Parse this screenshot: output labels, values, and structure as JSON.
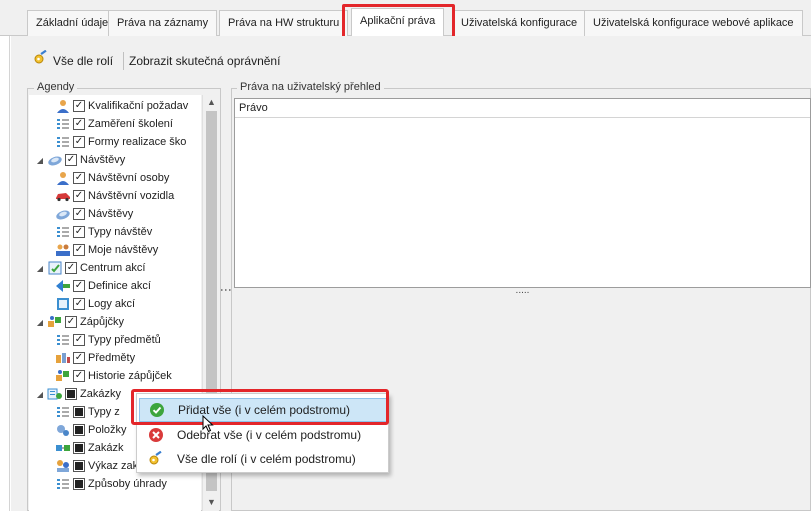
{
  "tabs": [
    {
      "label": "Základní údaje"
    },
    {
      "label": "Práva na záznamy"
    },
    {
      "label": "Práva na HW strukturu"
    },
    {
      "label": "Aplikační práva"
    },
    {
      "label": "Uživatelská konfigurace"
    },
    {
      "label": "Uživatelská konfigurace webové aplikace"
    }
  ],
  "toolbar": {
    "role_button": "Vše dle rolí",
    "show_button": "Zobrazit skutečná oprávnění"
  },
  "agendy": {
    "title": "Agendy",
    "items": [
      {
        "label": "Kvalifikační požadav",
        "icon": "person-icon",
        "checked": true
      },
      {
        "label": "Zaměření školení",
        "icon": "list-icon",
        "checked": true
      },
      {
        "label": "Formy realizace ško",
        "icon": "list-icon",
        "checked": true
      },
      {
        "label": "Návštěvy",
        "icon": "visit-icon",
        "checked": true
      },
      {
        "label": "Návštěvní osoby",
        "icon": "person-icon",
        "checked": true
      },
      {
        "label": "Návštěvní vozidla",
        "icon": "car-icon",
        "checked": true
      },
      {
        "label": "Návštěvy",
        "icon": "visit-icon",
        "checked": true
      },
      {
        "label": "Typy návštěv",
        "icon": "list-icon",
        "checked": true
      },
      {
        "label": "Moje návštěvy",
        "icon": "people-icon",
        "checked": true
      },
      {
        "label": "Centrum akcí",
        "icon": "action-center-icon",
        "checked": true
      },
      {
        "label": "Definice akcí",
        "icon": "flag-icon",
        "checked": true
      },
      {
        "label": "Logy akcí",
        "icon": "log-icon",
        "checked": true
      },
      {
        "label": "Zápůjčky",
        "icon": "loan-icon",
        "checked": true
      },
      {
        "label": "Typy předmětů",
        "icon": "list-icon",
        "checked": true
      },
      {
        "label": "Předměty",
        "icon": "items-icon",
        "checked": true
      },
      {
        "label": "Historie zápůjček",
        "icon": "loan-icon",
        "checked": true
      },
      {
        "label": "Zakázky",
        "icon": "orders-icon",
        "checked": "mixed"
      },
      {
        "label": "Typy z",
        "icon": "list-icon",
        "checked": "mixed"
      },
      {
        "label": "Položky",
        "icon": "item-icon",
        "checked": "mixed"
      },
      {
        "label": "Zakázk",
        "icon": "order-icon",
        "checked": "mixed"
      },
      {
        "label": "Výkaz zakázek",
        "icon": "report-icon",
        "checked": "mixed"
      },
      {
        "label": "Způsoby úhrady",
        "icon": "list-icon",
        "checked": "mixed"
      }
    ]
  },
  "rights": {
    "title": "Práva na uživatelský přehled",
    "column": "Právo",
    "splitter": "....."
  },
  "context_menu": {
    "items": [
      {
        "label": "Přidat vše (i v celém podstromu)",
        "icon": "check-circle-icon"
      },
      {
        "label": "Odebrat vše (i v celém podstromu)",
        "icon": "remove-circle-icon"
      },
      {
        "label": "Vše dle rolí (i v celém podstromu)",
        "icon": "role-key-icon"
      }
    ]
  },
  "colors": {
    "highlight_border": "#e3262a",
    "menu_hover": "#cde6f7"
  }
}
